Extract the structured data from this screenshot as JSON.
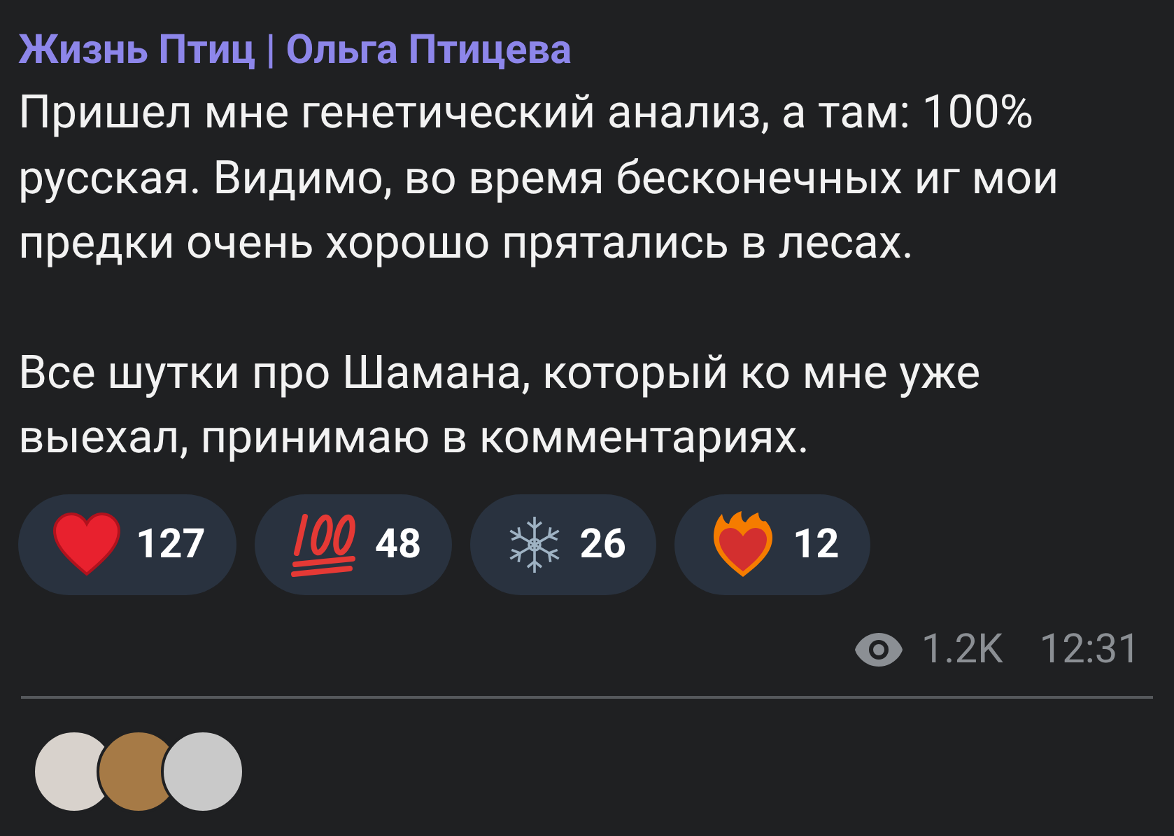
{
  "post": {
    "author": "Жизнь Птиц | Ольга Птицева",
    "paragraphs": [
      "Пришел мне генетический анализ, а там: 100% русская. Видимо, во время бесконечных иг мои предки очень хорошо прятались в лесах.",
      "Все шутки про Шамана, который ко мне уже выехал, принимаю в комментариях."
    ],
    "reactions": [
      {
        "kind": "heart",
        "count": "127"
      },
      {
        "kind": "hundred",
        "count": "48"
      },
      {
        "kind": "snowflake",
        "count": "26"
      },
      {
        "kind": "fire-heart",
        "count": "12"
      }
    ],
    "views": "1.2K",
    "time": "12:31"
  }
}
